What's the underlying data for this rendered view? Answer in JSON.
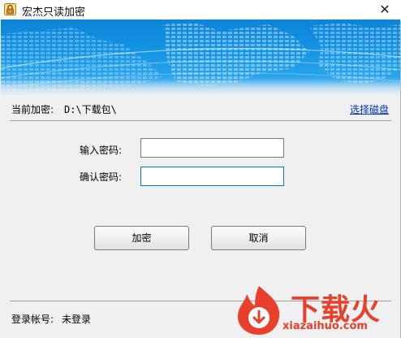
{
  "window": {
    "title": "宏杰只读加密",
    "close_glyph": "✕",
    "icon": "lock-icon"
  },
  "path": {
    "label": "当前加密:",
    "value": "D:\\下载包\\",
    "select_link": "选择磁盘"
  },
  "form": {
    "password_label": "输入密码:",
    "password_value": "",
    "confirm_label": "确认密码:",
    "confirm_value": ""
  },
  "buttons": {
    "encrypt": "加密",
    "cancel": "取消"
  },
  "status": {
    "label": "登录帐号:",
    "value": "未登录"
  },
  "watermark": {
    "brand": "下载火",
    "domain": "xiazaihuo.com"
  },
  "colors": {
    "banner": "#1596e4",
    "link": "#0033cc",
    "brand": "#e8402a"
  }
}
